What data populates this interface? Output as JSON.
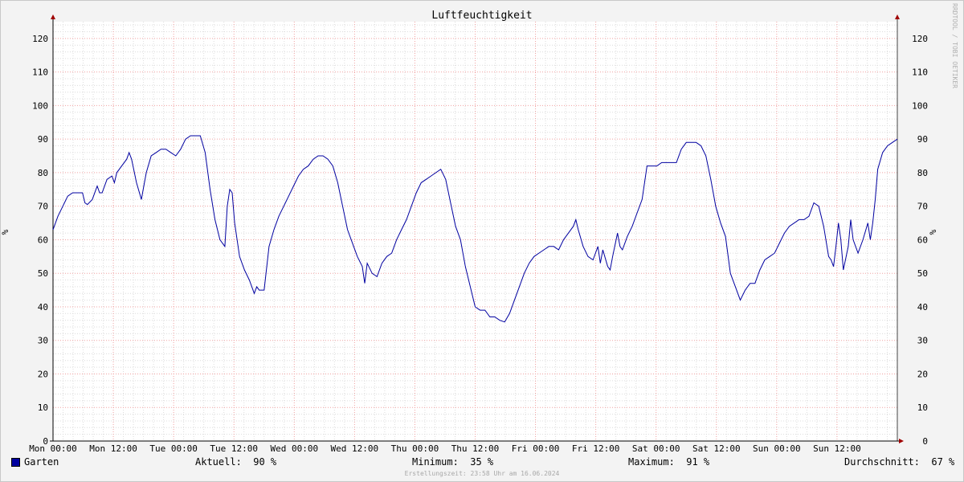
{
  "chart_data": {
    "type": "line",
    "title": "Luftfeuchtigkeit",
    "ylabel": "%",
    "ylim": [
      0,
      125
    ],
    "yticks": [
      0,
      10,
      20,
      30,
      40,
      50,
      60,
      70,
      80,
      90,
      100,
      110,
      120
    ],
    "xlim": [
      0,
      168
    ],
    "xticks": [
      {
        "x": 0,
        "label": "Mon 00:00"
      },
      {
        "x": 12,
        "label": "Mon 12:00"
      },
      {
        "x": 24,
        "label": "Tue 00:00"
      },
      {
        "x": 36,
        "label": "Tue 12:00"
      },
      {
        "x": 48,
        "label": "Wed 00:00"
      },
      {
        "x": 60,
        "label": "Wed 12:00"
      },
      {
        "x": 72,
        "label": "Thu 00:00"
      },
      {
        "x": 84,
        "label": "Thu 12:00"
      },
      {
        "x": 96,
        "label": "Fri 00:00"
      },
      {
        "x": 108,
        "label": "Fri 12:00"
      },
      {
        "x": 120,
        "label": "Sat 00:00"
      },
      {
        "x": 132,
        "label": "Sat 12:00"
      },
      {
        "x": 144,
        "label": "Sun 00:00"
      },
      {
        "x": 156,
        "label": "Sun 12:00"
      }
    ],
    "grid": true,
    "series": [
      {
        "name": "Garten",
        "color": "#0000a0",
        "points": [
          [
            0,
            63
          ],
          [
            1,
            67
          ],
          [
            2,
            70
          ],
          [
            3,
            73
          ],
          [
            4,
            74
          ],
          [
            5,
            74
          ],
          [
            6,
            74
          ],
          [
            6.5,
            71
          ],
          [
            7,
            70.5
          ],
          [
            8,
            72
          ],
          [
            9,
            76
          ],
          [
            9.5,
            74
          ],
          [
            10,
            74
          ],
          [
            11,
            78
          ],
          [
            12,
            79
          ],
          [
            12.5,
            77
          ],
          [
            13,
            80
          ],
          [
            14,
            82
          ],
          [
            15,
            84
          ],
          [
            15.5,
            86
          ],
          [
            16,
            84
          ],
          [
            17,
            77
          ],
          [
            18,
            72
          ],
          [
            18.5,
            76
          ],
          [
            19,
            80
          ],
          [
            20,
            85
          ],
          [
            21,
            86
          ],
          [
            22,
            87
          ],
          [
            23,
            87
          ],
          [
            24,
            86
          ],
          [
            25,
            85
          ],
          [
            26,
            87
          ],
          [
            27,
            90
          ],
          [
            28,
            91
          ],
          [
            29,
            91
          ],
          [
            30,
            91
          ],
          [
            31,
            86
          ],
          [
            32,
            75
          ],
          [
            33,
            66
          ],
          [
            34,
            60
          ],
          [
            35,
            58
          ],
          [
            35.5,
            70
          ],
          [
            36,
            75
          ],
          [
            36.5,
            74
          ],
          [
            37,
            65
          ],
          [
            38,
            55
          ],
          [
            39,
            51
          ],
          [
            40,
            48
          ],
          [
            41,
            44
          ],
          [
            41.5,
            46
          ],
          [
            42,
            45
          ],
          [
            43,
            45
          ],
          [
            44,
            58
          ],
          [
            45,
            63
          ],
          [
            46,
            67
          ],
          [
            47,
            70
          ],
          [
            48,
            73
          ],
          [
            49,
            76
          ],
          [
            50,
            79
          ],
          [
            51,
            81
          ],
          [
            52,
            82
          ],
          [
            53,
            84
          ],
          [
            54,
            85
          ],
          [
            55,
            85
          ],
          [
            56,
            84
          ],
          [
            57,
            82
          ],
          [
            58,
            77
          ],
          [
            59,
            70
          ],
          [
            60,
            63
          ],
          [
            61,
            59
          ],
          [
            62,
            55
          ],
          [
            63,
            52
          ],
          [
            63.5,
            47
          ],
          [
            64,
            53
          ],
          [
            65,
            50
          ],
          [
            66,
            49
          ],
          [
            67,
            53
          ],
          [
            68,
            55
          ],
          [
            69,
            56
          ],
          [
            70,
            60
          ],
          [
            71,
            63
          ],
          [
            72,
            66
          ],
          [
            73,
            70
          ],
          [
            74,
            74
          ],
          [
            75,
            77
          ],
          [
            76,
            78
          ],
          [
            77,
            79
          ],
          [
            78,
            80
          ],
          [
            79,
            81
          ],
          [
            80,
            78
          ],
          [
            81,
            71
          ],
          [
            82,
            64
          ],
          [
            83,
            60
          ],
          [
            84,
            52
          ],
          [
            85,
            46
          ],
          [
            86,
            40
          ],
          [
            87,
            39
          ],
          [
            88,
            39
          ],
          [
            89,
            37
          ],
          [
            90,
            37
          ],
          [
            91,
            36
          ],
          [
            92,
            35.5
          ],
          [
            93,
            38
          ],
          [
            94,
            42
          ],
          [
            95,
            46
          ],
          [
            96,
            50
          ],
          [
            97,
            53
          ],
          [
            98,
            55
          ],
          [
            99,
            56
          ],
          [
            100,
            57
          ],
          [
            101,
            58
          ],
          [
            102,
            58
          ],
          [
            103,
            57
          ],
          [
            104,
            60
          ],
          [
            105,
            62
          ],
          [
            106,
            64
          ],
          [
            106.5,
            66
          ],
          [
            107,
            63
          ],
          [
            108,
            58
          ],
          [
            109,
            55
          ],
          [
            110,
            54
          ],
          [
            111,
            58
          ],
          [
            111.5,
            53
          ],
          [
            112,
            57
          ],
          [
            113,
            52
          ],
          [
            113.5,
            51
          ],
          [
            114,
            55
          ],
          [
            115,
            62
          ],
          [
            115.5,
            58
          ],
          [
            116,
            57
          ],
          [
            117,
            61
          ],
          [
            118,
            64
          ],
          [
            119,
            68
          ],
          [
            120,
            72
          ],
          [
            121,
            82
          ],
          [
            122,
            82
          ],
          [
            123,
            82
          ],
          [
            124,
            83
          ],
          [
            125,
            83
          ],
          [
            126,
            83
          ],
          [
            127,
            83
          ],
          [
            128,
            87
          ],
          [
            129,
            89
          ],
          [
            130,
            89
          ],
          [
            131,
            89
          ],
          [
            132,
            88
          ],
          [
            133,
            85
          ],
          [
            134,
            78
          ],
          [
            135,
            70
          ],
          [
            136,
            65
          ],
          [
            137,
            61
          ],
          [
            138,
            50
          ],
          [
            139,
            46
          ],
          [
            140,
            42
          ],
          [
            141,
            45
          ],
          [
            142,
            47
          ],
          [
            143,
            47
          ],
          [
            144,
            51
          ],
          [
            145,
            54
          ],
          [
            146,
            55
          ],
          [
            147,
            56
          ],
          [
            148,
            59
          ],
          [
            149,
            62
          ],
          [
            150,
            64
          ],
          [
            151,
            65
          ],
          [
            152,
            66
          ],
          [
            153,
            66
          ],
          [
            154,
            67
          ],
          [
            155,
            71
          ],
          [
            156,
            70
          ],
          [
            157,
            64
          ],
          [
            158,
            55
          ],
          [
            158.5,
            54
          ],
          [
            159,
            52
          ],
          [
            159.5,
            58
          ],
          [
            160,
            65
          ],
          [
            160.5,
            60
          ],
          [
            161,
            51
          ],
          [
            162,
            58
          ],
          [
            162.5,
            66
          ],
          [
            163,
            60
          ],
          [
            164,
            56
          ],
          [
            165,
            60
          ],
          [
            166,
            65
          ],
          [
            166.5,
            60
          ],
          [
            167,
            65
          ],
          [
            167.5,
            72
          ],
          [
            168,
            81
          ],
          [
            169,
            86
          ],
          [
            170,
            88
          ],
          [
            171,
            89
          ],
          [
            172,
            90
          ]
        ]
      }
    ]
  },
  "legend": {
    "series_name": "Garten",
    "current_label": "Aktuell:",
    "current_value": "90 %",
    "min_label": "Minimum:",
    "min_value": "35 %",
    "max_label": "Maximum:",
    "max_value": "91 %",
    "avg_label": "Durchschnitt:",
    "avg_value": "67 %"
  },
  "footer_text": "Erstellungszeit: 23:58 Uhr am 16.06.2024",
  "watermark": "RRDTOOL / TOBI OETIKER"
}
